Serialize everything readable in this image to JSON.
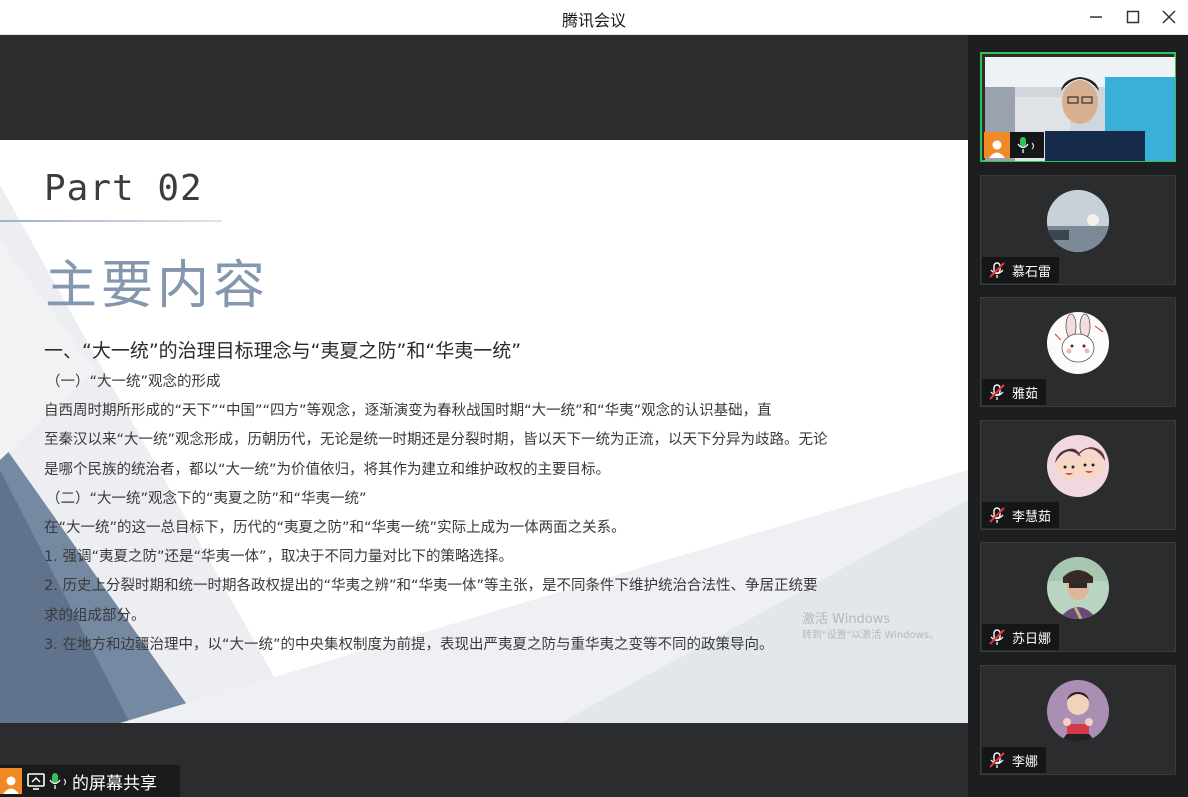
{
  "window": {
    "title": "腾讯会议",
    "controls": [
      "minimize-icon",
      "maximize-icon",
      "close-icon"
    ]
  },
  "slide": {
    "part_label": "Part 02",
    "title": "主要内容",
    "heading1": "一、“大一统”的治理目标理念与“夷夏之防”和“华夷一统”",
    "lines": [
      "（一）“大一统”观念的形成",
      "自西周时期所形成的“天下”“中国”“四方”等观念，逐渐演变为春秋战国时期“大一统”和“华夷”观念的认识基础，直",
      "至秦汉以来“大一统”观念形成，历朝历代，无论是统一时期还是分裂时期，皆以天下一统为正流，以天下分异为歧路。无论",
      "是哪个民族的统治者，都以“大一统”为价值依归，将其作为建立和维护政权的主要目标。",
      "（二）“大一统”观念下的“夷夏之防”和“华夷一统”",
      "在“大一统”的这一总目标下，历代的“夷夏之防”和“华夷一统”实际上成为一体两面之关系。",
      "1. 强调“夷夏之防”还是“华夷一体”，取决于不同力量对比下的策略选择。",
      "2. 历史上分裂时期和统一时期各政权提出的“华夷之辨”和“华夷一体”等主张，是不同条件下维护统治合法性、争居正统要",
      "求的组成部分。",
      "3. 在地方和边疆治理中，以“大一统”的中央集权制度为前提，表现出严夷夏之防与重华夷之变等不同的政策导向。"
    ],
    "watermark": {
      "line1": "激活 Windows",
      "line2": "转到\"设置\"以激活 Windows。"
    }
  },
  "sharer": {
    "label": "的屏幕共享"
  },
  "participants": [
    {
      "name": "",
      "video": true
    },
    {
      "name": "慕石雷",
      "muted": true
    },
    {
      "name": "雅茹",
      "muted": true
    },
    {
      "name": "李慧茹",
      "muted": true
    },
    {
      "name": "苏日娜",
      "muted": true
    },
    {
      "name": "李娜",
      "muted": true
    }
  ],
  "colors": {
    "active_border": "#30c25a",
    "avatar_orange": "#f08a24",
    "title_accent": "#8597ae"
  }
}
